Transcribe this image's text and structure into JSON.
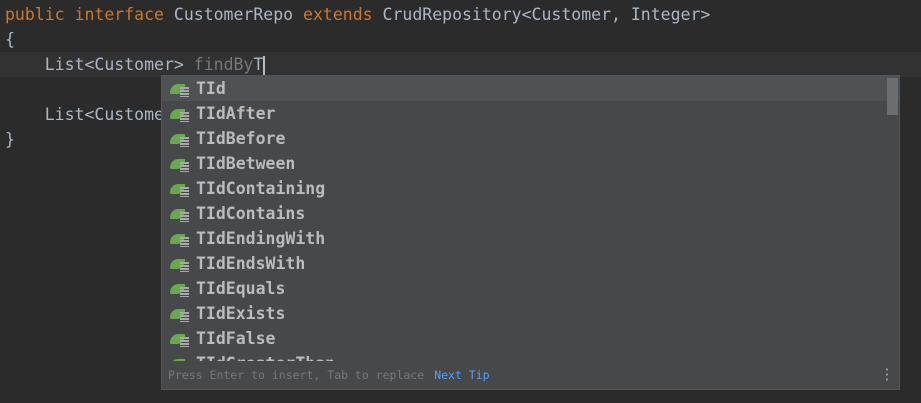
{
  "editor": {
    "line1": {
      "kw1": "public",
      "kw2": "interface",
      "name": "CustomerRepo",
      "kw3": "extends",
      "rest": "CrudRepository<Customer, Integer>"
    },
    "line2": "{",
    "line3": {
      "type": "List<Customer>",
      "ghost": "findBy",
      "typed": "T"
    },
    "line5": "List<Customer",
    "line6": "}"
  },
  "popup": {
    "items": [
      "TId",
      "TIdAfter",
      "TIdBefore",
      "TIdBetween",
      "TIdContaining",
      "TIdContains",
      "TIdEndingWith",
      "TIdEndsWith",
      "TIdEquals",
      "TIdExists",
      "TIdFalse",
      "TIdGreaterThan"
    ],
    "icon": "spring-data-method-icon",
    "footer_hint": "Press Enter to insert, Tab to replace",
    "next_tip": "Next Tip"
  },
  "colors": {
    "background": "#2b2b2b",
    "keyword": "#cc7832",
    "text": "#a9b7c6",
    "link": "#589df6",
    "icon": "#6aa84f"
  }
}
